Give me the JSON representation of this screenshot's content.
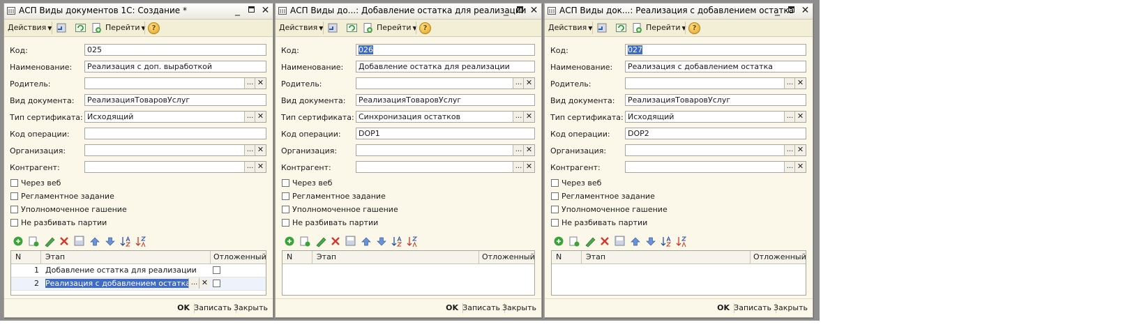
{
  "common": {
    "actions_label": "Действия",
    "goto_label": "Перейти",
    "help_label": "?",
    "ok_label": "OK",
    "save_label": "Записать",
    "close_label": "Закрыть",
    "labels": {
      "code": "Код:",
      "name": "Наименование:",
      "parent": "Родитель:",
      "doc_type": "Вид документа:",
      "cert_type": "Тип сертификата:",
      "op_code": "Код операции:",
      "organization": "Организация:",
      "counterparty": "Контрагент:"
    },
    "checkboxes": [
      "Через веб",
      "Регламентное задание",
      "Уполномоченное гашение",
      "Не разбивать партии"
    ],
    "grid_headers": {
      "n": "N",
      "stage": "Этап",
      "deferred": "Отложенный"
    },
    "select_btn": "...",
    "clear_btn": "✕"
  },
  "windows": [
    {
      "title": "АСП Виды документов 1С: Создание *",
      "code": "025",
      "code_selected": false,
      "name": "Реализация с доп. выработкой",
      "parent": "",
      "doc_type": "РеализацияТоваровУслуг",
      "cert_type": "Исходящий",
      "op_code": "",
      "organization": "",
      "counterparty": "",
      "rows": [
        {
          "n": "1",
          "stage": "Добавление остатка для реализации",
          "deferred": false
        },
        {
          "n": "2",
          "stage": "Реализация с добавлением остатка",
          "deferred": false
        }
      ]
    },
    {
      "title": "АСП Виды до...: Добавление остатка для реализации",
      "code": "026",
      "code_selected": true,
      "name": "Добавление остатка для реализации",
      "parent": "",
      "doc_type": "РеализацияТоваровУслуг",
      "cert_type": "Синхронизация остатков",
      "op_code": "DOP1",
      "organization": "",
      "counterparty": "",
      "rows": []
    },
    {
      "title": "АСП Виды док...: Реализация с добавлением остатка",
      "code": "027",
      "code_selected": true,
      "name": "Реализация с добавлением остатка",
      "parent": "",
      "doc_type": "РеализацияТоваровУслуг",
      "cert_type": "Исходящий",
      "op_code": "DOP2",
      "organization": "",
      "counterparty": "",
      "rows": []
    }
  ]
}
